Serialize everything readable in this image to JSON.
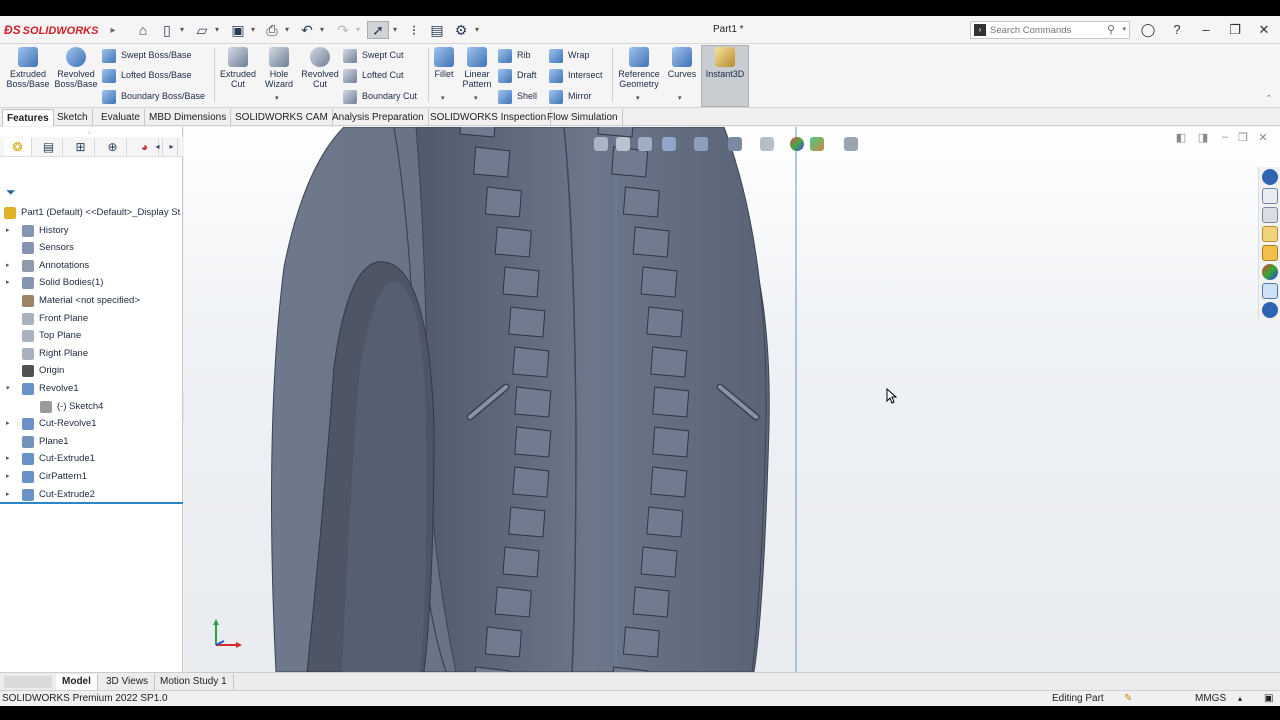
{
  "app": {
    "brand": "SOLIDWORKS",
    "document_title": "Part1 *",
    "search": {
      "placeholder": "Search Commands"
    }
  },
  "ribbon": {
    "big_buttons": [
      {
        "label": "Extruded\nBoss/Base",
        "icon": "extruded-boss-icon"
      },
      {
        "label": "Revolved\nBoss/Base",
        "icon": "revolved-boss-icon"
      },
      {
        "label": "Extruded\nCut",
        "icon": "extruded-cut-icon"
      },
      {
        "label": "Hole\nWizard",
        "icon": "hole-wizard-icon"
      },
      {
        "label": "Revolved\nCut",
        "icon": "revolved-cut-icon"
      },
      {
        "label": "Fillet",
        "icon": "fillet-icon"
      },
      {
        "label": "Linear\nPattern",
        "icon": "linear-pattern-icon"
      },
      {
        "label": "Reference\nGeometry",
        "icon": "reference-geometry-icon"
      },
      {
        "label": "Curves",
        "icon": "curves-icon"
      },
      {
        "label": "Instant3D",
        "icon": "instant3d-icon"
      }
    ],
    "small_buttons": [
      {
        "label": "Swept Boss/Base"
      },
      {
        "label": "Lofted Boss/Base"
      },
      {
        "label": "Boundary Boss/Base"
      },
      {
        "label": "Swept Cut"
      },
      {
        "label": "Lofted Cut"
      },
      {
        "label": "Boundary Cut"
      },
      {
        "label": "Rib"
      },
      {
        "label": "Draft"
      },
      {
        "label": "Shell"
      },
      {
        "label": "Wrap"
      },
      {
        "label": "Intersect"
      },
      {
        "label": "Mirror"
      }
    ]
  },
  "tabs": [
    "Features",
    "Sketch",
    "Evaluate",
    "MBD Dimensions",
    "SOLIDWORKS CAM",
    "Analysis Preparation",
    "SOLIDWORKS Inspection",
    "Flow Simulation"
  ],
  "feature_tree": [
    {
      "label": "Part1 (Default) <<Default>_Display St",
      "icon": "part-icon"
    },
    {
      "label": "History",
      "icon": "history-icon"
    },
    {
      "label": "Sensors",
      "icon": "sensors-icon"
    },
    {
      "label": "Annotations",
      "icon": "annotations-icon"
    },
    {
      "label": "Solid Bodies(1)",
      "icon": "solid-bodies-icon"
    },
    {
      "label": "Material <not specified>",
      "icon": "material-icon"
    },
    {
      "label": "Front Plane",
      "icon": "plane-icon"
    },
    {
      "label": "Top Plane",
      "icon": "plane-icon"
    },
    {
      "label": "Right Plane",
      "icon": "plane-icon"
    },
    {
      "label": "Origin",
      "icon": "origin-icon"
    },
    {
      "label": "Revolve1",
      "icon": "revolve-icon"
    },
    {
      "label": "(-) Sketch4",
      "icon": "sketch-icon"
    },
    {
      "label": "Cut-Revolve1",
      "icon": "cut-revolve-icon"
    },
    {
      "label": "Plane1",
      "icon": "plane-icon"
    },
    {
      "label": "Cut-Extrude1",
      "icon": "cut-extrude-icon"
    },
    {
      "label": "CirPattern1",
      "icon": "circular-pattern-icon"
    },
    {
      "label": "Cut-Extrude2",
      "icon": "cut-extrude-icon"
    }
  ],
  "bottom_tabs": [
    "Model",
    "3D Views",
    "Motion Study 1"
  ],
  "status": {
    "product": "SOLIDWORKS Premium 2022 SP1.0",
    "mode": "Editing Part",
    "units": "MMGS"
  },
  "colors": {
    "brand_red": "#d0202a",
    "accent_blue": "#2b5fa8",
    "tire_dark": "#5d677a",
    "tire_light": "#7f8ba0"
  }
}
